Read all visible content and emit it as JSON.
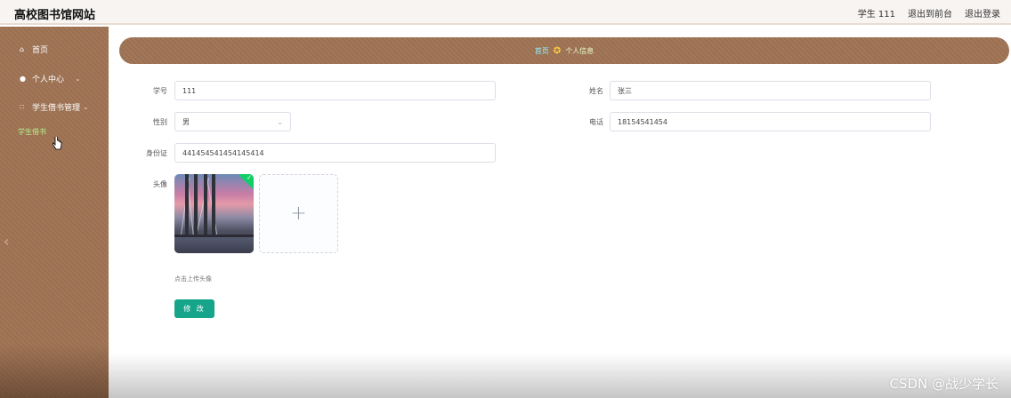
{
  "header": {
    "title": "高校图书馆网站",
    "user": "学生 111",
    "back_to_front": "退出到前台",
    "logout": "退出登录"
  },
  "sidebar": {
    "items": [
      {
        "label": "首页",
        "icon": "home-icon"
      },
      {
        "label": "个人中心",
        "icon": "user-icon"
      },
      {
        "label": "学生借书管理",
        "icon": "grid-icon"
      }
    ],
    "active_sub": "学生借书"
  },
  "breadcrumb": {
    "home": "首页",
    "current": "个人信息"
  },
  "form": {
    "student_id": {
      "label": "学号",
      "value": "111"
    },
    "name": {
      "label": "姓名",
      "value": "张三"
    },
    "gender": {
      "label": "性别",
      "value": "男"
    },
    "phone": {
      "label": "电话",
      "value": "18154541454"
    },
    "id_card": {
      "label": "身份证",
      "value": "441454541454145414"
    },
    "avatar": {
      "label": "头像"
    },
    "upload_hint": "点击上传头像",
    "submit": "修 改"
  },
  "watermark": "CSDN @战少学长",
  "colors": {
    "sidebar": "#a07455",
    "accent": "#16a58a",
    "active_sub": "#b6f08a"
  }
}
